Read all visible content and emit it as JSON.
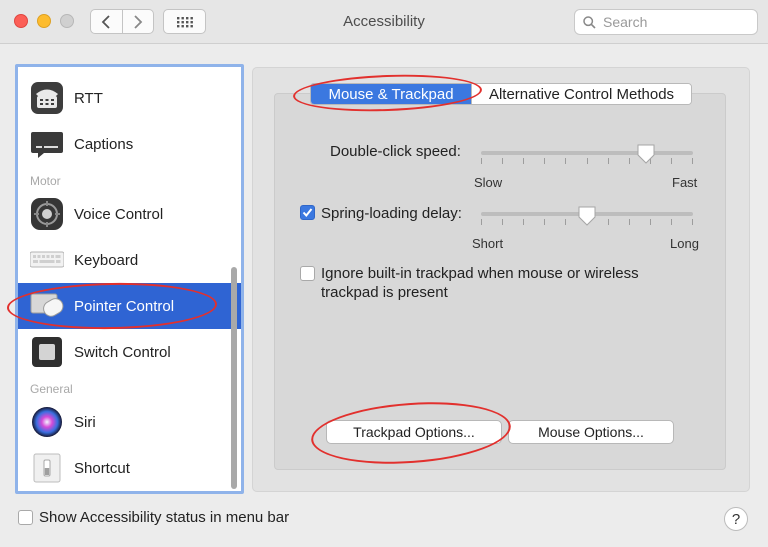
{
  "window": {
    "title": "Accessibility"
  },
  "search": {
    "placeholder": "Search"
  },
  "sidebar": {
    "items": [
      {
        "label": "RTT",
        "icon": "telephone-icon"
      },
      {
        "label": "Captions",
        "icon": "captions-icon"
      },
      {
        "header": "Motor"
      },
      {
        "label": "Voice Control",
        "icon": "voice-control-icon"
      },
      {
        "label": "Keyboard",
        "icon": "keyboard-icon"
      },
      {
        "label": "Pointer Control",
        "icon": "pointer-control-icon",
        "selected": true
      },
      {
        "label": "Switch Control",
        "icon": "switch-control-icon"
      },
      {
        "header": "General"
      },
      {
        "label": "Siri",
        "icon": "siri-icon"
      },
      {
        "label": "Shortcut",
        "icon": "shortcut-icon"
      }
    ]
  },
  "tabs": [
    {
      "label": "Mouse & Trackpad",
      "active": true
    },
    {
      "label": "Alternative Control Methods",
      "active": false
    }
  ],
  "double_click": {
    "label": "Double-click speed:",
    "min": "Slow",
    "max": "Fast",
    "value": 0.78
  },
  "spring_loading": {
    "label": "Spring-loading delay:",
    "checked": true,
    "min": "Short",
    "max": "Long",
    "value": 0.5
  },
  "ignore_trackpad": {
    "label_line1": "Ignore built-in trackpad when mouse or wireless",
    "label_line2": "trackpad is present",
    "checked": false
  },
  "buttons": {
    "trackpad_options": "Trackpad Options...",
    "mouse_options": "Mouse Options..."
  },
  "footer": {
    "status_label": "Show Accessibility status in menu bar",
    "status_checked": false,
    "help": "?"
  },
  "colors": {
    "accent": "#3b78e0",
    "selection": "#2f64d3",
    "annotation": "#e2302d"
  }
}
